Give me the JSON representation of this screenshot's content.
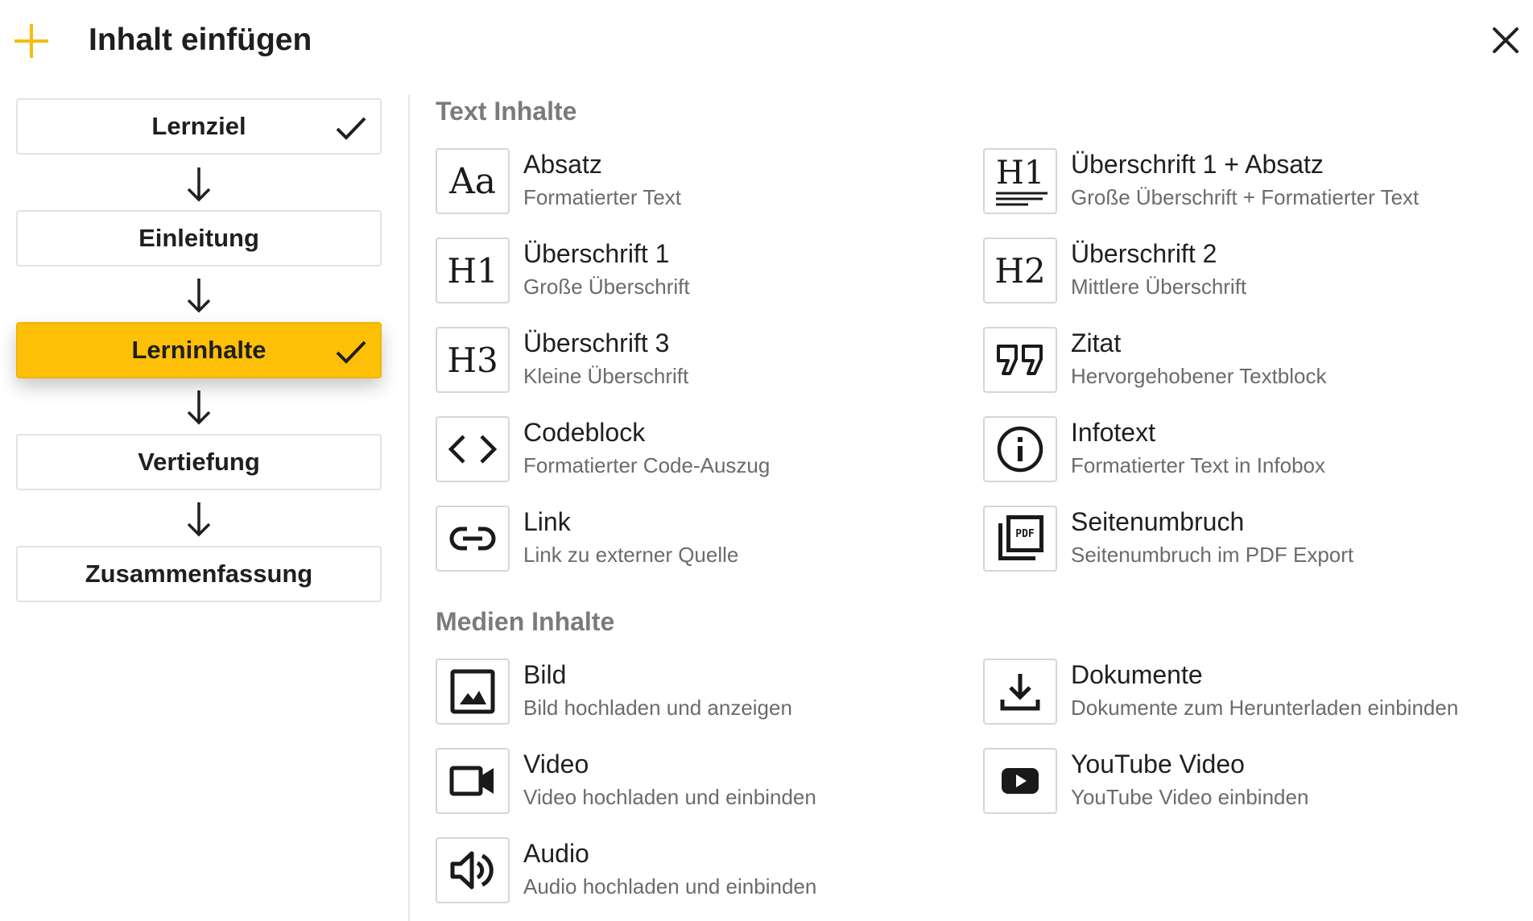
{
  "header": {
    "title": "Inhalt einfügen",
    "plus_icon": "plus-icon",
    "close_icon": "close-icon"
  },
  "steps": [
    {
      "label": "Lernziel",
      "checked": true,
      "active": false
    },
    {
      "label": "Einleitung",
      "checked": false,
      "active": false
    },
    {
      "label": "Lerninhalte",
      "checked": true,
      "active": true
    },
    {
      "label": "Vertiefung",
      "checked": false,
      "active": false
    },
    {
      "label": "Zusammenfassung",
      "checked": false,
      "active": false
    }
  ],
  "text_section": {
    "title": "Text Inhalte",
    "items": [
      {
        "name": "Absatz",
        "desc": "Formatierter Text",
        "icon": "Aa"
      },
      {
        "name": "Überschrift 1 + Absatz",
        "desc": "Große Überschrift + Formatierter Text",
        "icon": "H1"
      },
      {
        "name": "Überschrift 1",
        "desc": "Große Überschrift",
        "icon": "H1"
      },
      {
        "name": "Überschrift 2",
        "desc": "Mittlere Überschrift",
        "icon": "H2"
      },
      {
        "name": "Überschrift 3",
        "desc": "Kleine Überschrift",
        "icon": "H3"
      },
      {
        "name": "Zitat",
        "desc": "Hervorgehobener Textblock",
        "icon": "quote-icon"
      },
      {
        "name": "Codeblock",
        "desc": "Formatierter Code-Auszug",
        "icon": "code-icon"
      },
      {
        "name": "Infotext",
        "desc": "Formatierter Text in Infobox",
        "icon": "info-icon"
      },
      {
        "name": "Link",
        "desc": "Link zu externer Quelle",
        "icon": "link-icon"
      },
      {
        "name": "Seitenumbruch",
        "desc": "Seitenumbruch im PDF Export",
        "icon": "PDF"
      }
    ]
  },
  "media_section": {
    "title": "Medien Inhalte",
    "items": [
      {
        "name": "Bild",
        "desc": "Bild hochladen und anzeigen",
        "icon": "image-icon"
      },
      {
        "name": "Dokumente",
        "desc": "Dokumente zum Herunterladen einbinden",
        "icon": "download-icon"
      },
      {
        "name": "Video",
        "desc": "Video hochladen und einbinden",
        "icon": "video-icon"
      },
      {
        "name": "YouTube Video",
        "desc": "YouTube Video einbinden",
        "icon": "youtube-icon"
      },
      {
        "name": "Audio",
        "desc": "Audio hochladen und einbinden",
        "icon": "audio-icon"
      }
    ]
  },
  "colors": {
    "accent": "#fdc007",
    "plus": "#f5bd0c",
    "muted_text": "#6b6b6b",
    "section_title": "#7b7b7b"
  }
}
